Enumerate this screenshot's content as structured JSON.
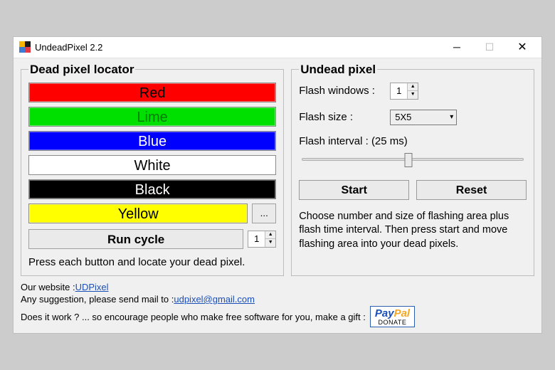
{
  "window": {
    "title": "UndeadPixel 2.2"
  },
  "locator": {
    "legend": "Dead pixel locator",
    "colors": {
      "red": {
        "label": "Red",
        "bg": "#ff0000",
        "fg": "#000000"
      },
      "lime": {
        "label": "Lime",
        "bg": "#00e000",
        "fg": "#008000"
      },
      "blue": {
        "label": "Blue",
        "bg": "#0000ff",
        "fg": "#ffffff"
      },
      "white": {
        "label": "White",
        "bg": "#ffffff",
        "fg": "#000000"
      },
      "black": {
        "label": "Black",
        "bg": "#000000",
        "fg": "#ffffff"
      },
      "yellow": {
        "label": "Yellow",
        "bg": "#ffff00",
        "fg": "#000000"
      }
    },
    "more_label": "...",
    "run_label": "Run cycle",
    "run_count": "1",
    "hint": "Press each button and locate your dead pixel."
  },
  "undead": {
    "legend": "Undead pixel",
    "flash_windows_label": "Flash windows :",
    "flash_windows_value": "1",
    "flash_size_label": "Flash size :",
    "flash_size_value": "5X5",
    "flash_interval_label": "Flash interval :  (25 ms)",
    "start_label": "Start",
    "reset_label": "Reset",
    "description": "Choose number and size of flashing area plus flash time interval. Then press start and move flashing area into your dead pixels."
  },
  "footer": {
    "website_label": "Our website : ",
    "website_link": "UDPixel",
    "mail_label": "Any suggestion, please send mail to :  ",
    "mail_link": "udpixel@gmail.com",
    "donate_label": "Does it work ? ... so encourage people who make free software for you, make a gift :",
    "paypal_top": "PayPal",
    "paypal_bottom": "DONATE"
  }
}
